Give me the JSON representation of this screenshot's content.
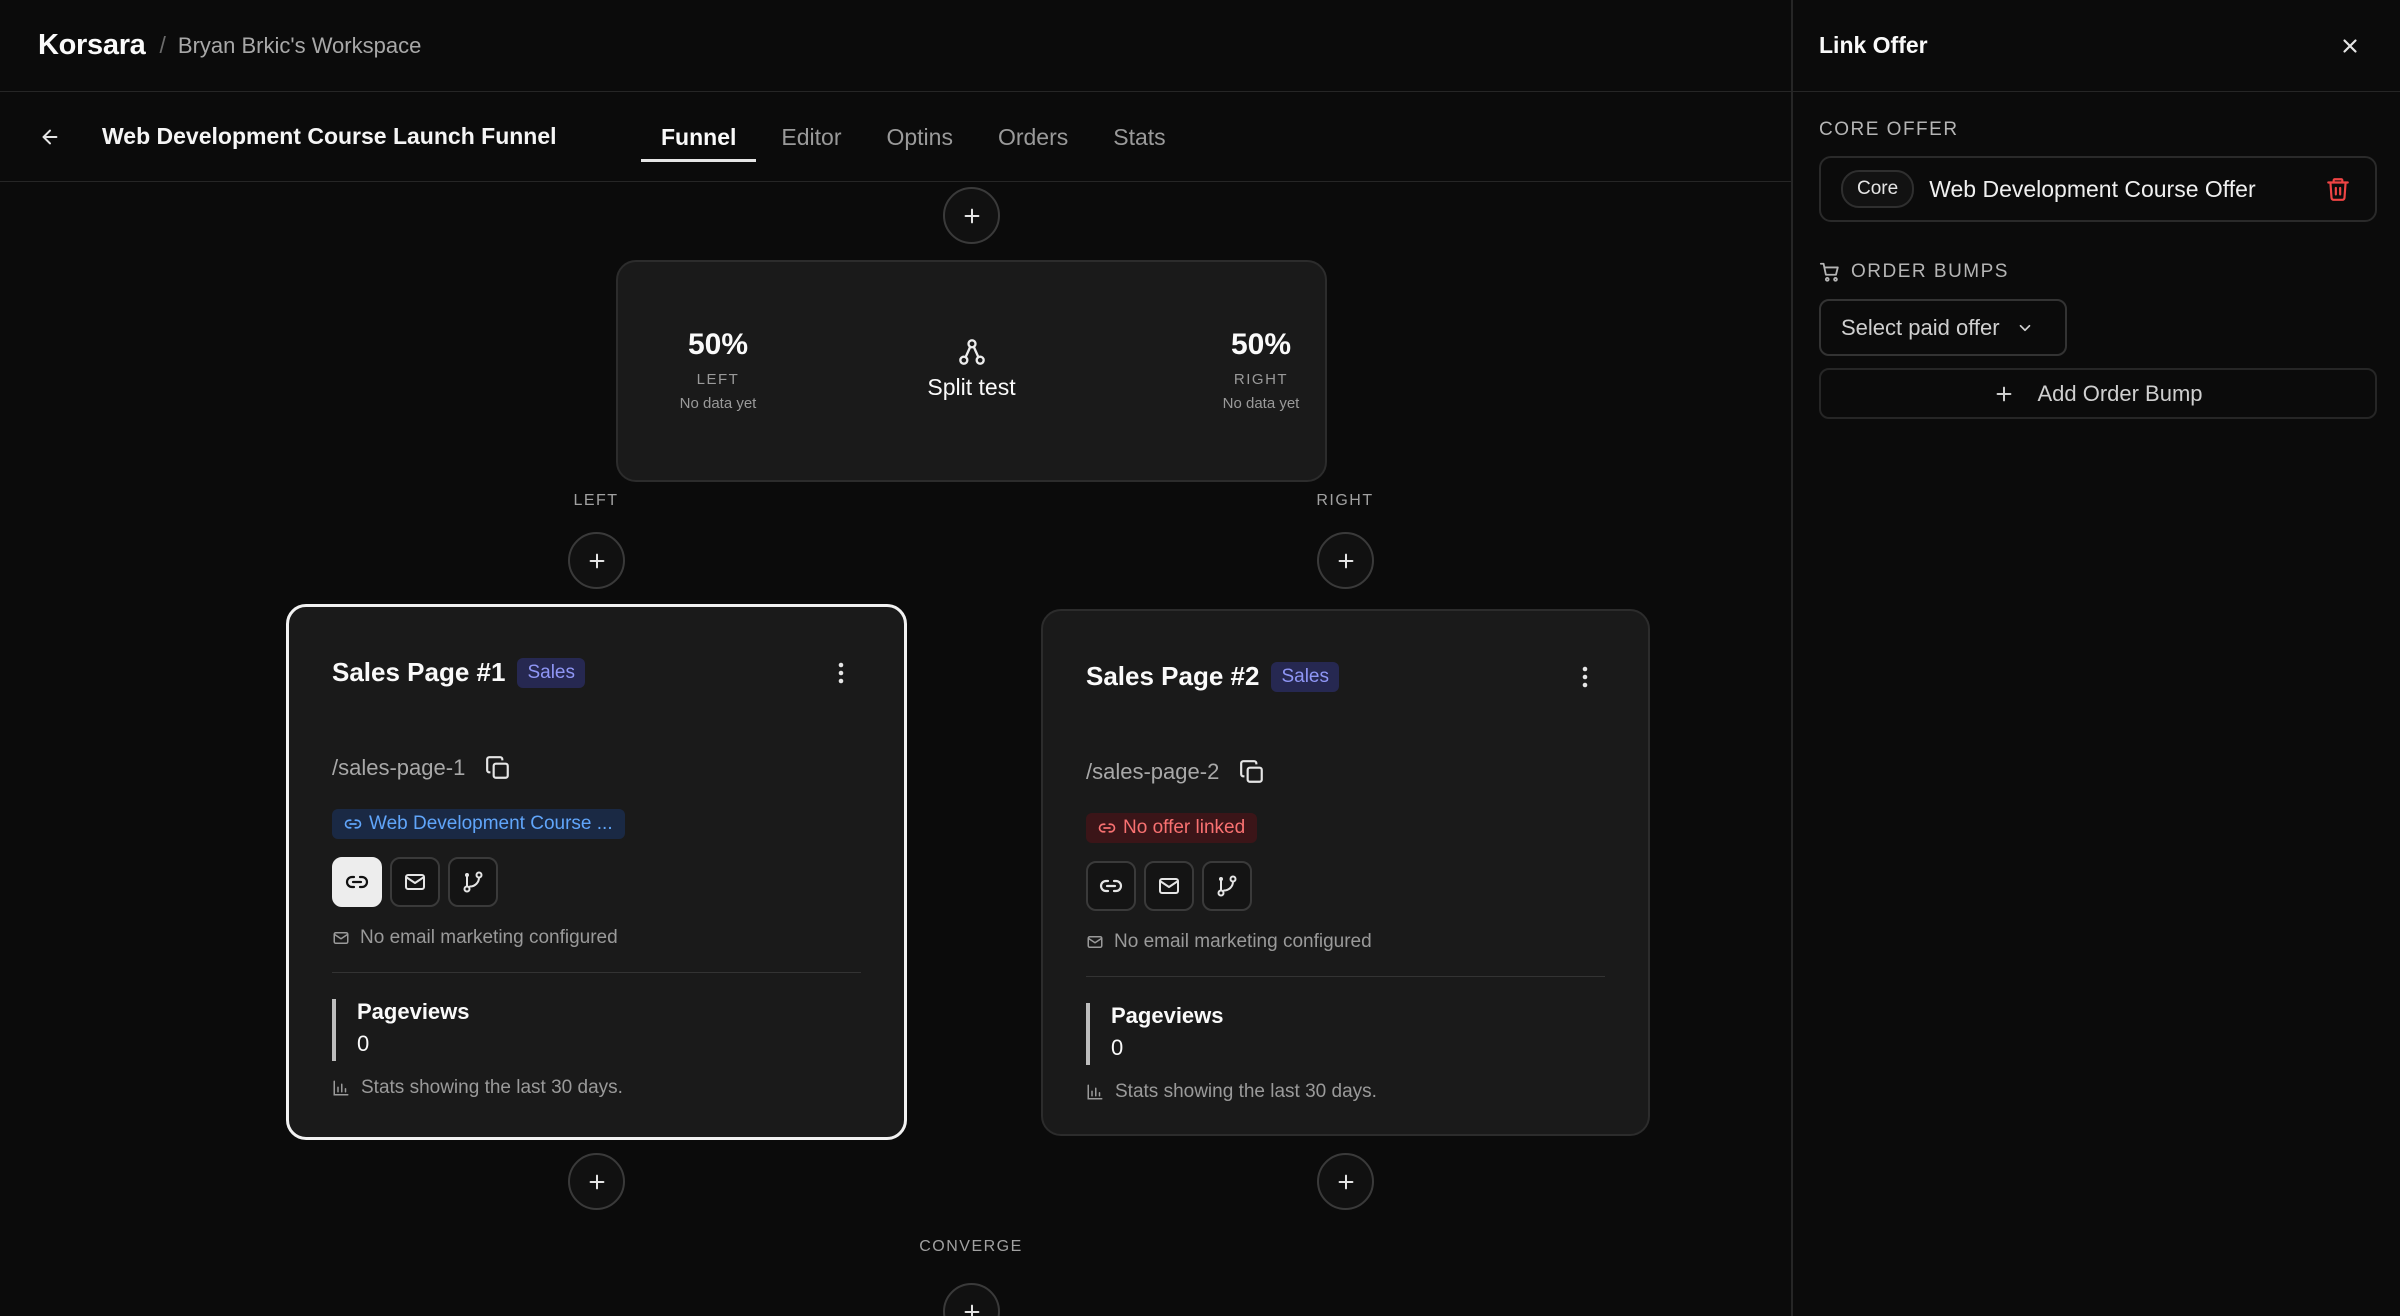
{
  "header": {
    "brand": "Korsara",
    "separator": "/",
    "workspace": "Bryan Brkic's Workspace"
  },
  "funnel": {
    "title": "Web Development Course Launch Funnel",
    "tabs": [
      {
        "label": "Funnel",
        "active": true
      },
      {
        "label": "Editor",
        "active": false
      },
      {
        "label": "Optins",
        "active": false
      },
      {
        "label": "Orders",
        "active": false
      },
      {
        "label": "Stats",
        "active": false
      }
    ]
  },
  "split_test": {
    "label": "Split test",
    "left": {
      "pct": "50%",
      "side": "LEFT",
      "note": "No data yet"
    },
    "right": {
      "pct": "50%",
      "side": "RIGHT",
      "note": "No data yet"
    }
  },
  "branches": {
    "left_label": "LEFT",
    "right_label": "RIGHT",
    "converge_label": "CONVERGE"
  },
  "pages": [
    {
      "name": "Sales Page #1",
      "badge": "Sales",
      "slug": "/sales-page-1",
      "offer_tag": "Web Development Course ...",
      "offer_linked": true,
      "email_note": "No email marketing configured",
      "metric_label": "Pageviews",
      "metric_value": "0",
      "stats_note": "Stats showing the last 30 days.",
      "selected": true
    },
    {
      "name": "Sales Page #2",
      "badge": "Sales",
      "slug": "/sales-page-2",
      "offer_tag": "No offer linked",
      "offer_linked": false,
      "email_note": "No email marketing configured",
      "metric_label": "Pageviews",
      "metric_value": "0",
      "stats_note": "Stats showing the last 30 days.",
      "selected": false
    }
  ],
  "panel": {
    "title": "Link Offer",
    "core_offer_label": "CORE OFFER",
    "core_pill": "Core",
    "core_offer_name": "Web Development Course Offer",
    "order_bumps_label": "ORDER BUMPS",
    "select_placeholder": "Select paid offer",
    "add_bump_label": "Add Order Bump"
  },
  "colors": {
    "background": "#0b0b0b",
    "card": "#1a1a1a",
    "badge_text": "#8f96f5",
    "linked_text": "#60a5fa",
    "unlinked_text": "#f87171",
    "danger": "#ef4444"
  },
  "icons": [
    "arrow-left-icon",
    "plus-icon",
    "split-icon",
    "kebab-icon",
    "copy-icon",
    "link-icon",
    "mail-icon",
    "branch-icon",
    "bar-chart-icon",
    "close-icon",
    "trash-icon",
    "cart-icon",
    "chevron-down-icon"
  ]
}
